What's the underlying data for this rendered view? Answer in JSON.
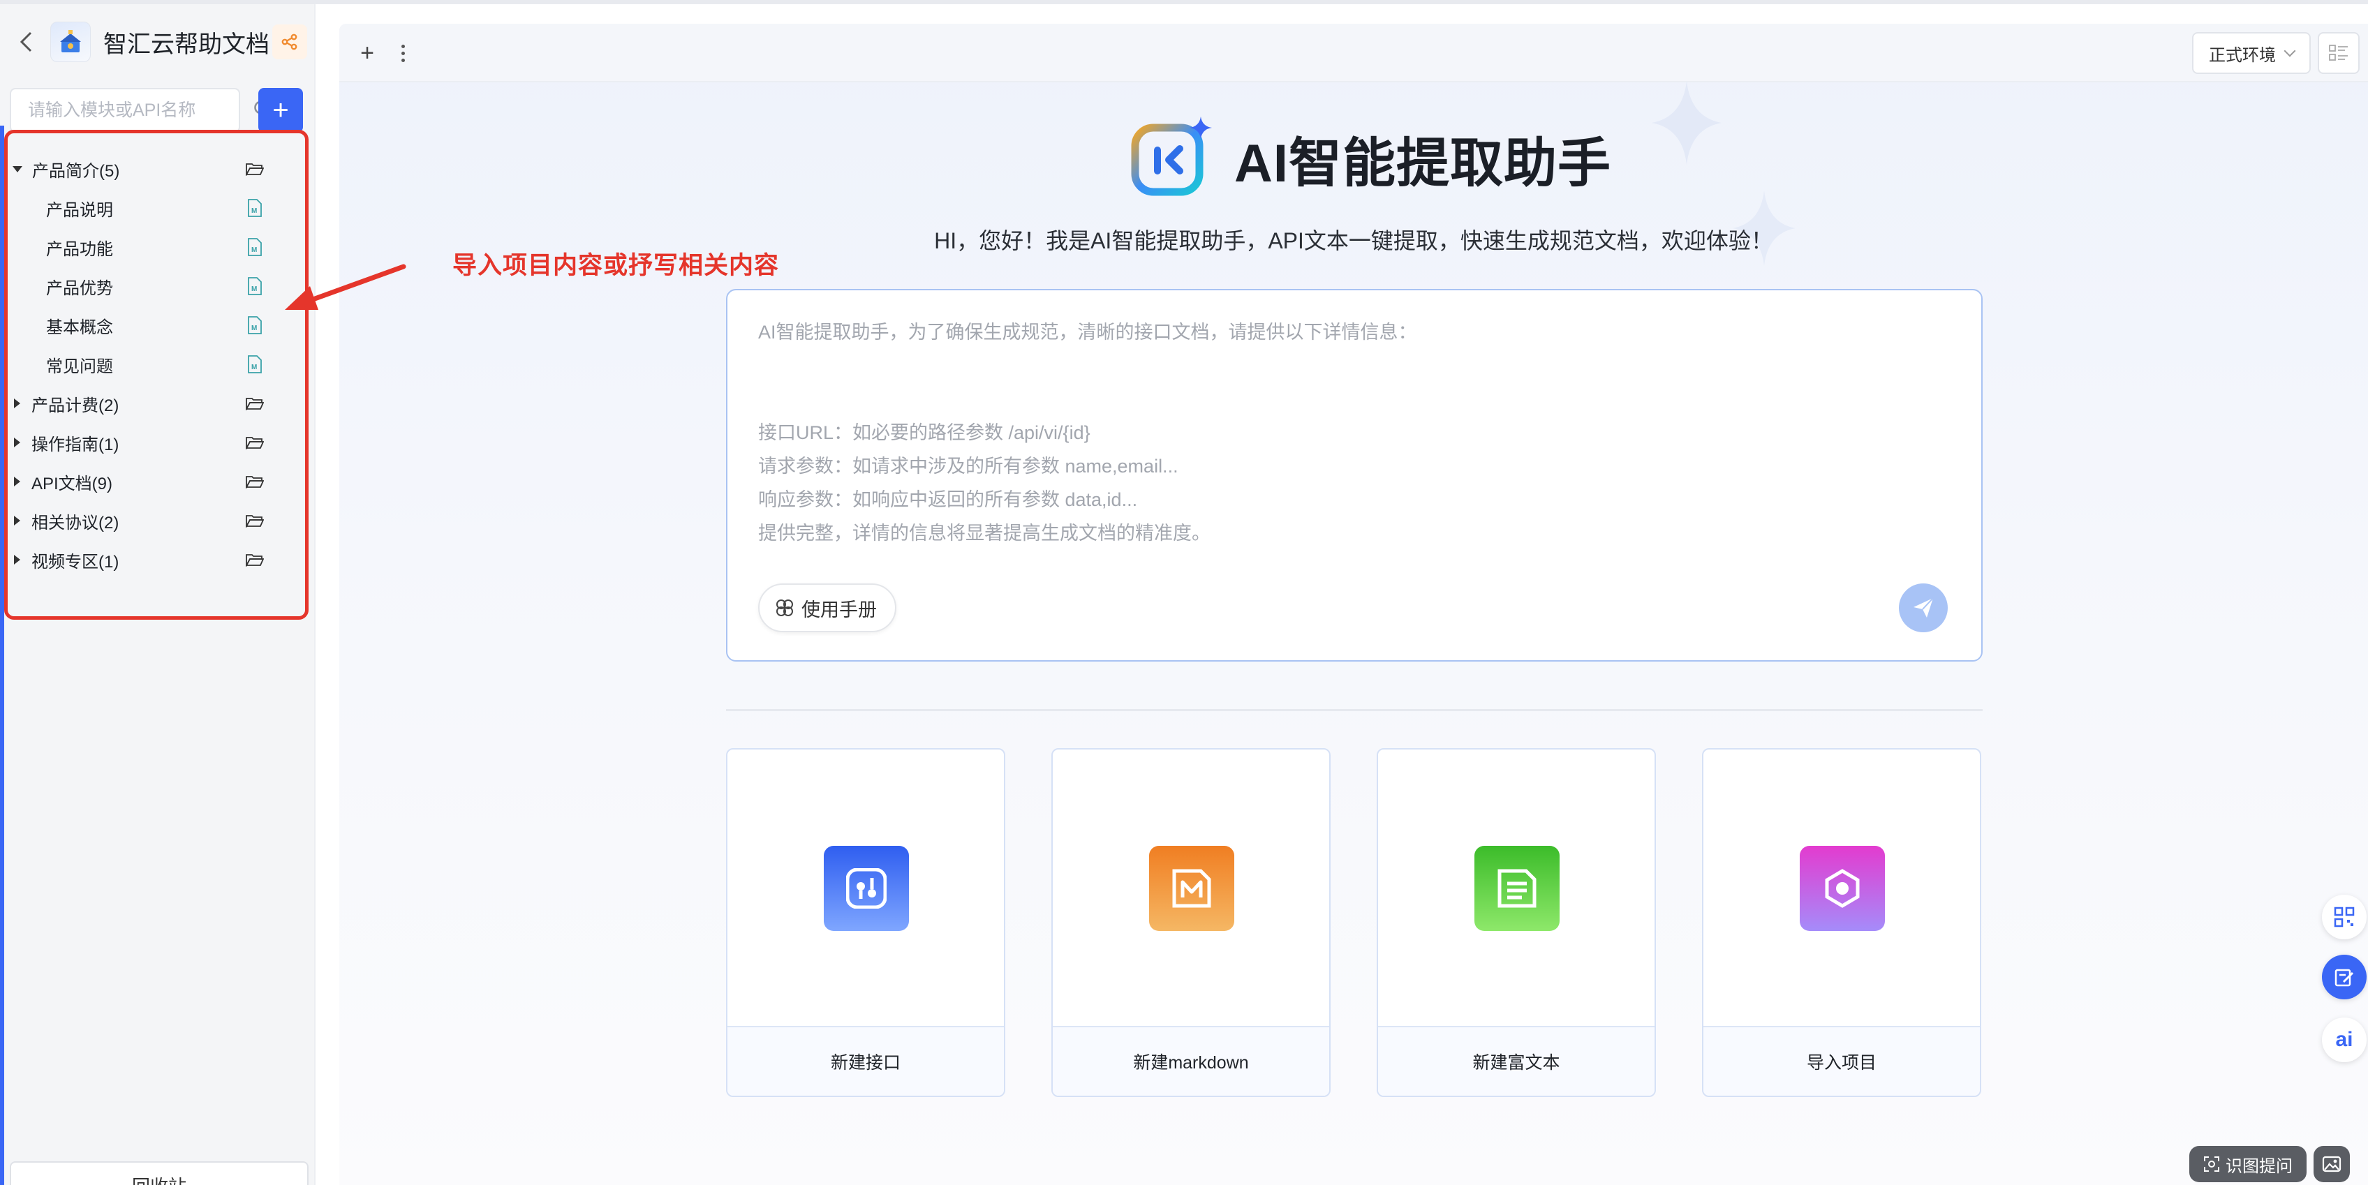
{
  "project": {
    "title": "智汇云帮助文档"
  },
  "search": {
    "placeholder": "请输入模块或API名称"
  },
  "add_button": {
    "label": "+"
  },
  "tree": [
    {
      "label": "产品简介(5)",
      "expanded": true,
      "children": [
        "产品说明",
        "产品功能",
        "产品优势",
        "基本概念",
        "常见问题"
      ]
    },
    {
      "label": "产品计费(2)",
      "expanded": false
    },
    {
      "label": "操作指南(1)",
      "expanded": false
    },
    {
      "label": "API文档(9)",
      "expanded": false
    },
    {
      "label": "相关协议(2)",
      "expanded": false
    },
    {
      "label": "视频专区(1)",
      "expanded": false
    }
  ],
  "recycle": {
    "label": "回收站"
  },
  "toolbar": {
    "add": "+",
    "env": "正式环境"
  },
  "hero": {
    "title": "AI智能提取助手",
    "subtitle": "HI，您好！我是AI智能提取助手，API文本一键提取，快速生成规范文档，欢迎体验！"
  },
  "prompt": {
    "intro": "AI智能提取助手，为了确保生成规范，清晰的接口文档，请提供以下详情信息：",
    "line_url": "接口URL：如必要的路径参数 /api/vi/{id}",
    "line_req": "请求参数：如请求中涉及的所有参数 name,email...",
    "line_resp": "响应参数：如响应中返回的所有参数 data,id...",
    "line_tip": "提供完整，详情的信息将显著提高生成文档的精准度。",
    "manual_label": "使用手册"
  },
  "cards": [
    {
      "label": "新建接口",
      "color": "#3f6df4"
    },
    {
      "label": "新建markdown",
      "color": "#f08a2e"
    },
    {
      "label": "新建富文本",
      "color": "#4cc72e"
    },
    {
      "label": "导入项目",
      "color": "#e04ad0"
    }
  ],
  "annotation": {
    "text": "导入项目内容或抒写相关内容",
    "color": "#e5352b"
  },
  "floating": {
    "ocr_label": "识图提问",
    "ai_label": "ai"
  },
  "colors": {
    "accent": "#3a66f5",
    "annotation": "#e5352b"
  },
  "icons": [
    "back-icon",
    "share-icon",
    "search-icon",
    "folder-icon",
    "markdown-file-icon",
    "more-icon",
    "layout-icon",
    "send-icon",
    "manual-icon",
    "qrcode-icon",
    "edit-icon",
    "image-icon"
  ]
}
